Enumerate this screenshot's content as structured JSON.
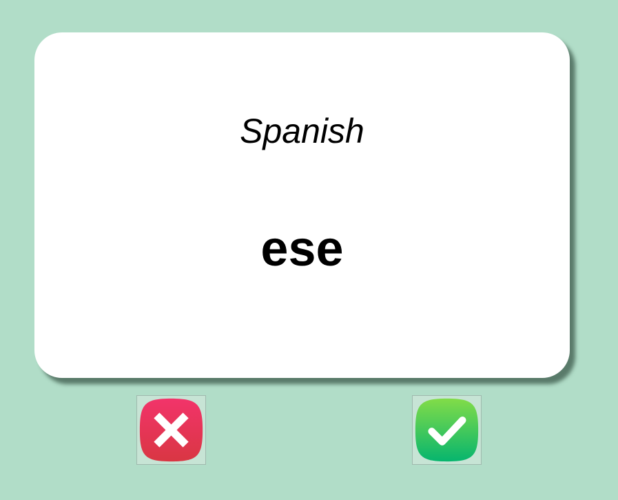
{
  "card": {
    "language": "Spanish",
    "word": "ese"
  },
  "buttons": {
    "wrong_icon": "x-icon",
    "right_icon": "checkmark-icon"
  },
  "colors": {
    "background": "#b1ddc8",
    "card": "#ffffff",
    "wrong_top": "#f2346a",
    "wrong_bottom": "#d93643",
    "right_top": "#82dc48",
    "right_bottom": "#06b56e"
  }
}
